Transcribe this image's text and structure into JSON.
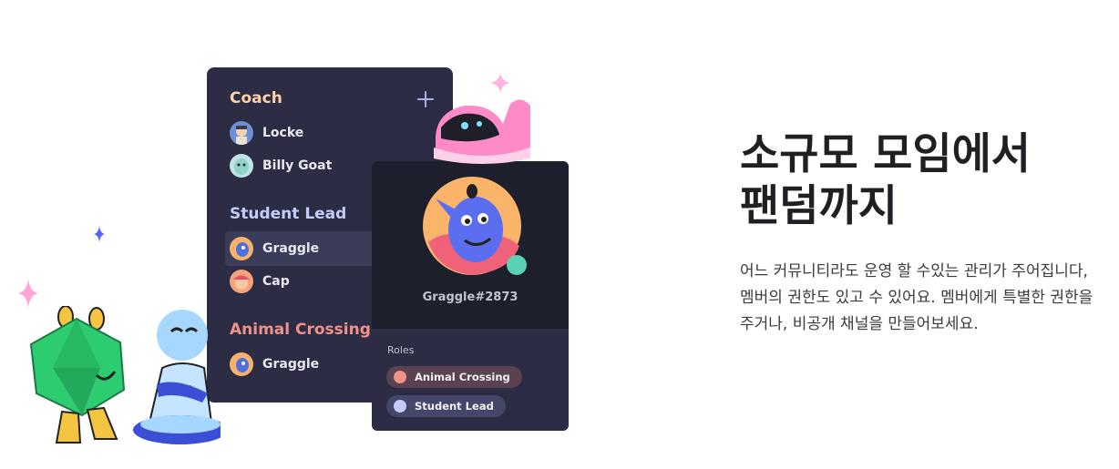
{
  "panel": {
    "add_icon": "plus-icon",
    "groups": [
      {
        "title": "Coach",
        "color": "#ffd3a7",
        "members": [
          {
            "name": "Locke"
          },
          {
            "name": "Billy Goat"
          }
        ]
      },
      {
        "title": "Student Lead",
        "color": "#c2cdfa",
        "members": [
          {
            "name": "Graggle"
          },
          {
            "name": "Cap"
          }
        ]
      },
      {
        "title": "Animal Crossing",
        "color": "#f0928a",
        "members": [
          {
            "name": "Graggle"
          }
        ]
      }
    ]
  },
  "profile": {
    "username": "Graggle#2873",
    "roles_label": "Roles",
    "roles": [
      {
        "name": "Animal Crossing",
        "color": "#f0928a",
        "bg": "#5a4250"
      },
      {
        "name": "Student Lead",
        "color": "#c2cdfa",
        "bg": "#45476a"
      }
    ]
  },
  "headline": {
    "line1": "소규모 모임에서",
    "line2": "팬덤까지"
  },
  "description": "어느 커뮤니티라도 운영 할 수있는 관리가 주어집니다, 멤버의 권한도 있고 수 있어요. 멤버에게 특별한 권한을 주거나, 비공개 채널을 만들어보세요.",
  "colors": {
    "panel_bg": "#2c2d44",
    "card_header": "#1e1f2c",
    "text_dark": "#1f2023"
  }
}
